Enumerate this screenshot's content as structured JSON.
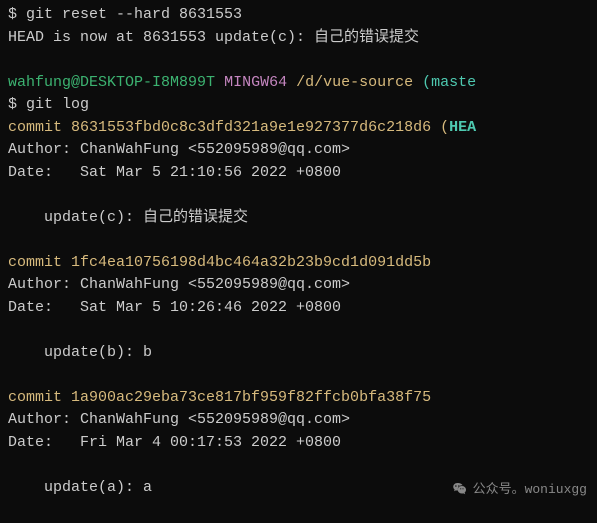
{
  "reset": {
    "prompt": "$ ",
    "command": "git reset --hard 8631553",
    "output": "HEAD is now at 8631553 update(c): 自己的错误提交"
  },
  "prompt_line": {
    "user": "wahfung",
    "at": "@",
    "host": "DESKTOP-I8M899T",
    "space1": " ",
    "mingw": "MINGW64",
    "space2": " ",
    "path": "/d/vue-source",
    "space3": " ",
    "branch_open": "(",
    "branch": "maste"
  },
  "log": {
    "prompt": "$ ",
    "command": "git log"
  },
  "commits": [
    {
      "commit_label": "commit ",
      "hash": "8631553fbd0c8c3dfd321a9e1e927377d6c218d6",
      "ref_open": " (",
      "ref": "HEA",
      "author": "Author: ChanWahFung <552095989@qq.com>",
      "date": "Date:   Sat Mar 5 21:10:56 2022 +0800",
      "message": "    update(c): 自己的错误提交"
    },
    {
      "commit_label": "commit ",
      "hash": "1fc4ea10756198d4bc464a32b23b9cd1d091dd5b",
      "author": "Author: ChanWahFung <552095989@qq.com>",
      "date": "Date:   Sat Mar 5 10:26:46 2022 +0800",
      "message": "    update(b): b"
    },
    {
      "commit_label": "commit ",
      "hash": "1a900ac29eba73ce817bf959f82ffcb0bfa38f75",
      "author": "Author: ChanWahFung <552095989@qq.com>",
      "date": "Date:   Fri Mar 4 00:17:53 2022 +0800",
      "message": "    update(a): a"
    }
  ],
  "watermark": {
    "text": "公众号。woniuxgg"
  }
}
